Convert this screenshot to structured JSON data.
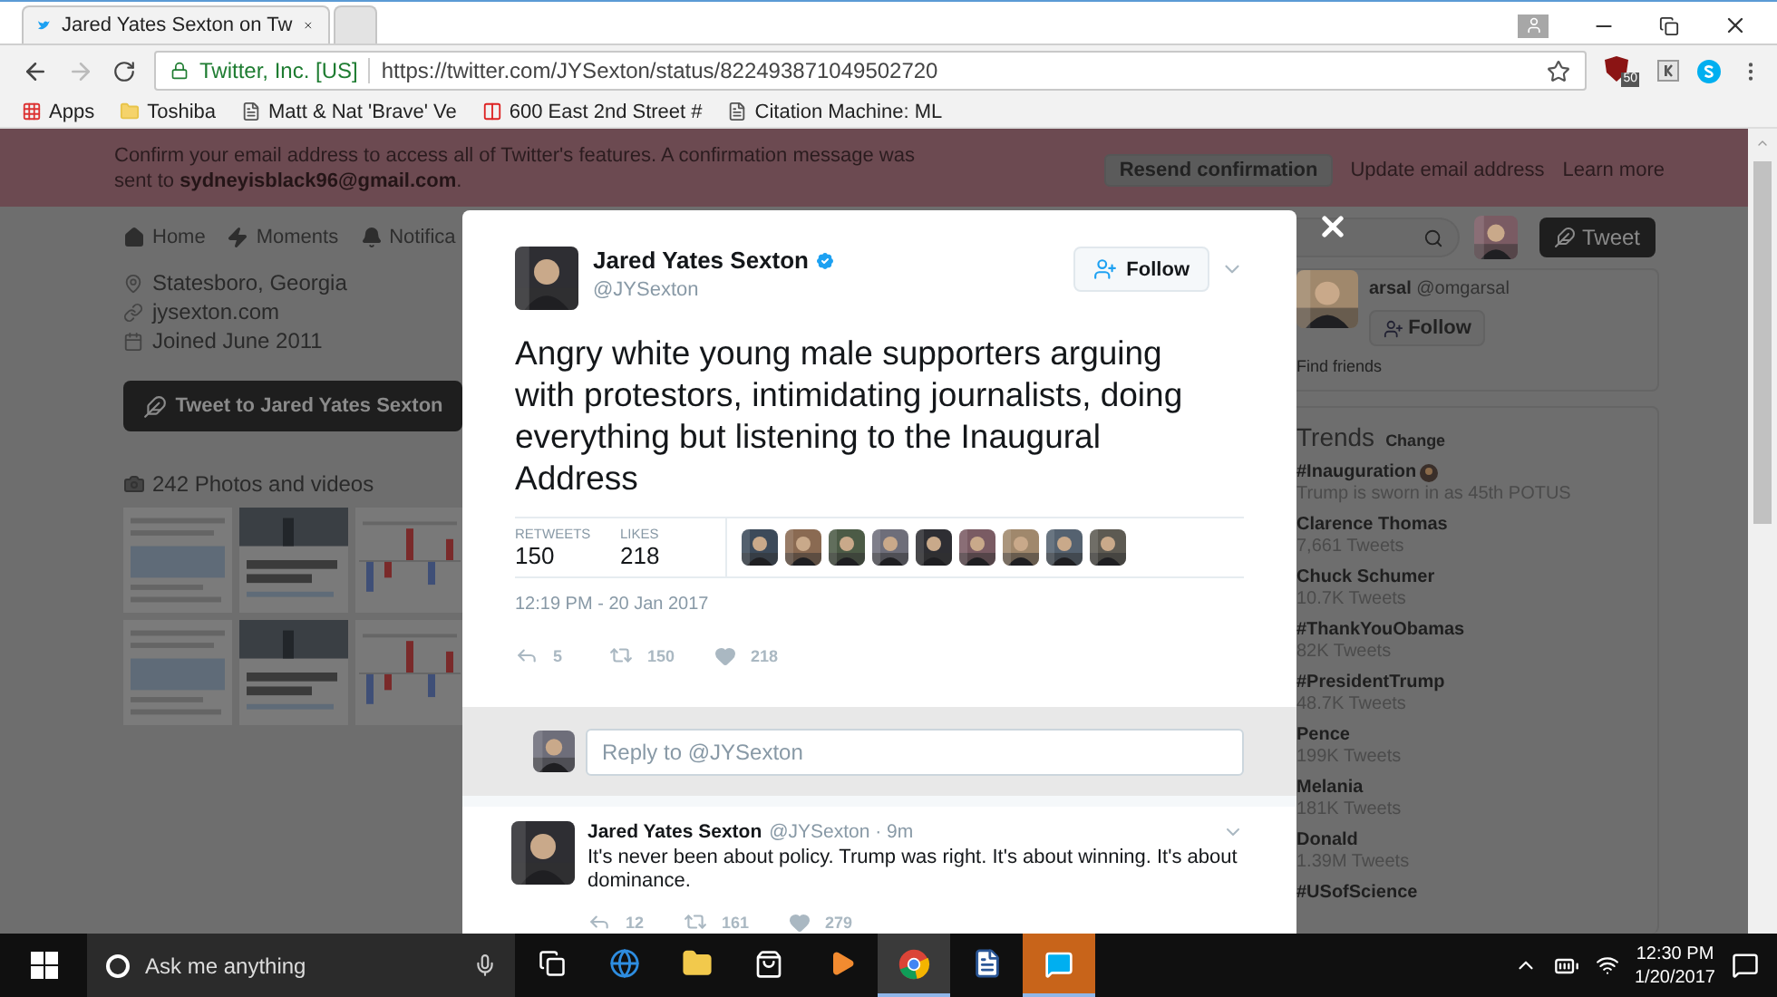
{
  "browser": {
    "tabs": [
      {
        "title": "Jared Yates Sexton on Tw",
        "selected": true
      },
      {
        "selected": false
      }
    ],
    "site_identity": "Twitter, Inc. [US]",
    "url": "https://twitter.com/JYSexton/status/822493871049502720",
    "extension_badge": "50",
    "bookmarks": [
      {
        "kind": "apps",
        "label": "Apps"
      },
      {
        "kind": "folder",
        "label": "Toshiba"
      },
      {
        "kind": "page",
        "label": "Matt & Nat 'Brave' Ve"
      },
      {
        "kind": "bars",
        "label": "600 East 2nd Street #"
      },
      {
        "kind": "page",
        "label": "Citation Machine: ML"
      }
    ]
  },
  "banner": {
    "message": "Confirm your email address to access all of Twitter's features. A confirmation message was sent to **sydneyisblack96@gmail.com**.",
    "resend": "Resend confirmation",
    "links": [
      "Update email address",
      "Learn more"
    ]
  },
  "nav": [
    {
      "kind": "home",
      "label": "Home"
    },
    {
      "kind": "moments",
      "label": "Moments"
    },
    {
      "kind": "notifications",
      "label": "Notifica"
    }
  ],
  "profile": {
    "location": "Statesboro, Georgia",
    "website": "jysexton.com",
    "joined": "Joined June 2011",
    "tweet_to": "Tweet to Jared Yates Sexton",
    "photos_header": "242 Photos and videos"
  },
  "header_right": {
    "tweet_button": "Tweet"
  },
  "who_to_follow": {
    "name": "arsal",
    "handle": "@omgarsal",
    "follow": "Follow",
    "find_friends": "Find friends"
  },
  "trends": {
    "title": "Trends",
    "change": "Change",
    "items": [
      {
        "name": "#Inauguration",
        "detail": "Trump is sworn in as 45th POTUS",
        "emoji": true
      },
      {
        "name": "Clarence Thomas",
        "detail": "7,661 Tweets",
        "emoji": false
      },
      {
        "name": "Chuck Schumer",
        "detail": "10.7K Tweets",
        "emoji": false
      },
      {
        "name": "#ThankYouObamas",
        "detail": "82K Tweets",
        "emoji": false
      },
      {
        "name": "#PresidentTrump",
        "detail": "48.7K Tweets",
        "emoji": false
      },
      {
        "name": "Pence",
        "detail": "199K Tweets",
        "emoji": false
      },
      {
        "name": "Melania",
        "detail": "181K Tweets",
        "emoji": false
      },
      {
        "name": "Donald",
        "detail": "1.39M Tweets",
        "emoji": false
      },
      {
        "name": "#USofScience",
        "emoji": false
      }
    ]
  },
  "tweet": {
    "name": "Jared Yates Sexton",
    "handle": "@JYSexton",
    "verified": true,
    "follow": "Follow",
    "text": "Angry white young male supporters arguing with protestors, intimidating journalists, doing everything but listening to the Inaugural Address",
    "stats": [
      {
        "label": "RETWEETS",
        "value": "150"
      },
      {
        "label": "LIKES",
        "value": "218"
      }
    ],
    "timestamp": "12:19 PM - 20 Jan 2017",
    "actions": [
      {
        "kind": "reply",
        "count": "5"
      },
      {
        "kind": "retweet",
        "count": "150"
      },
      {
        "kind": "like",
        "count": "218"
      }
    ]
  },
  "reply_box": {
    "placeholder": "Reply to @JYSexton"
  },
  "reply": {
    "name": "Jared Yates Sexton",
    "meta": "@JYSexton · 9m",
    "text": "It's never been about policy. Trump was right. It's about winning. It's about dominance.",
    "actions": [
      {
        "kind": "reply",
        "count": "12"
      },
      {
        "kind": "retweet",
        "count": "161"
      },
      {
        "kind": "like",
        "count": "279"
      }
    ]
  },
  "taskbar": {
    "search_placeholder": "Ask me anything",
    "apps": [
      {
        "kind": "taskview",
        "selected": false
      },
      {
        "kind": "edge",
        "selected": false
      },
      {
        "kind": "explorer",
        "selected": false
      },
      {
        "kind": "store",
        "selected": false
      },
      {
        "kind": "media",
        "selected": false
      },
      {
        "kind": "chrome",
        "selected": true
      },
      {
        "kind": "word",
        "selected": false
      },
      {
        "kind": "skype",
        "selected": true
      }
    ],
    "time": "12:30 PM",
    "date": "1/20/2017"
  }
}
